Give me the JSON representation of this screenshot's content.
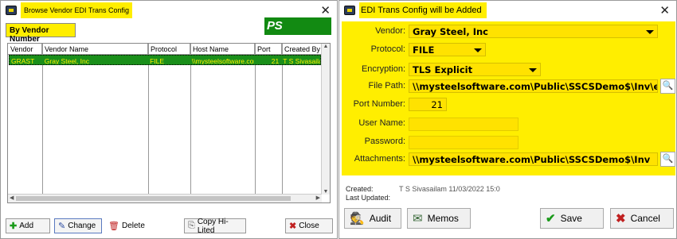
{
  "left": {
    "title": "Browse Vendor EDI Trans Config",
    "tab": "By Vendor Number",
    "logo": "PS Data.Net",
    "columns": [
      "Vendor",
      "Vendor Name",
      "Protocol",
      "Host Name",
      "Port",
      "Created By"
    ],
    "rows": [
      [
        "GRAST",
        "Gray Steel, Inc",
        "FILE",
        "\\\\mysteelsoftware.com",
        "21",
        "T S Sivasailam"
      ]
    ],
    "buttons": {
      "add": "Add",
      "change": "Change",
      "delete": "Delete",
      "copy": "Copy Hi-Lited",
      "close": "Close"
    }
  },
  "right": {
    "title": "EDI Trans Config will be Added",
    "labels": {
      "vendor": "Vendor:",
      "protocol": "Protocol:",
      "encryption": "Encryption:",
      "file_path": "File Path:",
      "port": "Port Number:",
      "user": "User Name:",
      "password": "Password:",
      "attachments": "Attachments:"
    },
    "values": {
      "vendor": "Gray Steel, Inc",
      "protocol": "FILE",
      "encryption": "TLS Explicit",
      "file_path": "\\\\mysteelsoftware.com\\Public\\SSCSDemo$\\Inv\\edi\\",
      "port": "21",
      "user": "",
      "password": "",
      "attachments": "\\\\mysteelsoftware.com\\Public\\SSCSDemo$\\Inv"
    },
    "meta": {
      "created_label": "Created:",
      "created_value": "T S Sivasailam 11/03/2022 15:0",
      "updated_label": "Last Updated:",
      "updated_value": ""
    },
    "buttons": {
      "audit": "Audit",
      "memos": "Memos",
      "save": "Save",
      "cancel": "Cancel"
    }
  }
}
